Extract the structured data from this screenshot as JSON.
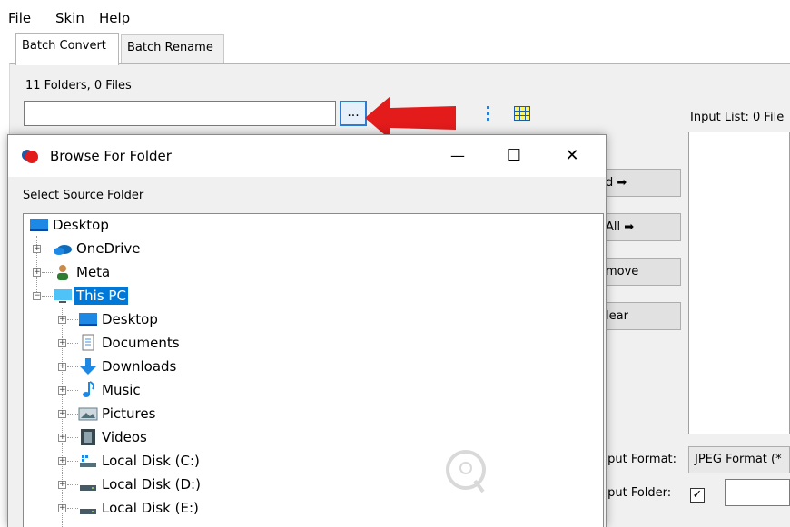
{
  "menu": [
    "File",
    "Skin",
    "Help"
  ],
  "tabs": {
    "batch_convert": "Batch Convert",
    "batch_rename": "Batch Rename"
  },
  "status": {
    "counts": "11 Folders, 0 Files"
  },
  "browse_button": {
    "label": "..."
  },
  "input_list": {
    "label": "Input List: 0 File"
  },
  "side_buttons": {
    "add": "d ➡",
    "add_all": "All ➡",
    "remove": "move",
    "clear": "lear"
  },
  "output": {
    "format_label": "tput Format:",
    "format_value": "JPEG Format (*",
    "folder_label": "tput Folder:",
    "folder_checked": true
  },
  "dialog": {
    "title": "Browse For Folder",
    "instruction": "Select Source Folder",
    "controls": {
      "minimize": "—",
      "maximize": "☐",
      "close": "✕"
    },
    "tree": [
      {
        "label": "Desktop",
        "icon": "desktop-icon"
      },
      {
        "label": "OneDrive",
        "icon": "onedrive-icon"
      },
      {
        "label": "Meta",
        "icon": "user-icon"
      },
      {
        "label": "This PC",
        "icon": "this-pc-icon",
        "selected": true
      },
      {
        "label": "Desktop",
        "icon": "desktop-icon"
      },
      {
        "label": "Documents",
        "icon": "documents-icon"
      },
      {
        "label": "Downloads",
        "icon": "downloads-icon"
      },
      {
        "label": "Music",
        "icon": "music-icon"
      },
      {
        "label": "Pictures",
        "icon": "pictures-icon"
      },
      {
        "label": "Videos",
        "icon": "videos-icon"
      },
      {
        "label": "Local Disk (C:)",
        "icon": "system-drive-icon"
      },
      {
        "label": "Local Disk (D:)",
        "icon": "drive-icon"
      },
      {
        "label": "Local Disk (E:)",
        "icon": "drive-icon"
      }
    ]
  },
  "colors": {
    "selection": "#0078d7",
    "arrow": "#e31b1b",
    "accent": "#2b7cd3"
  }
}
